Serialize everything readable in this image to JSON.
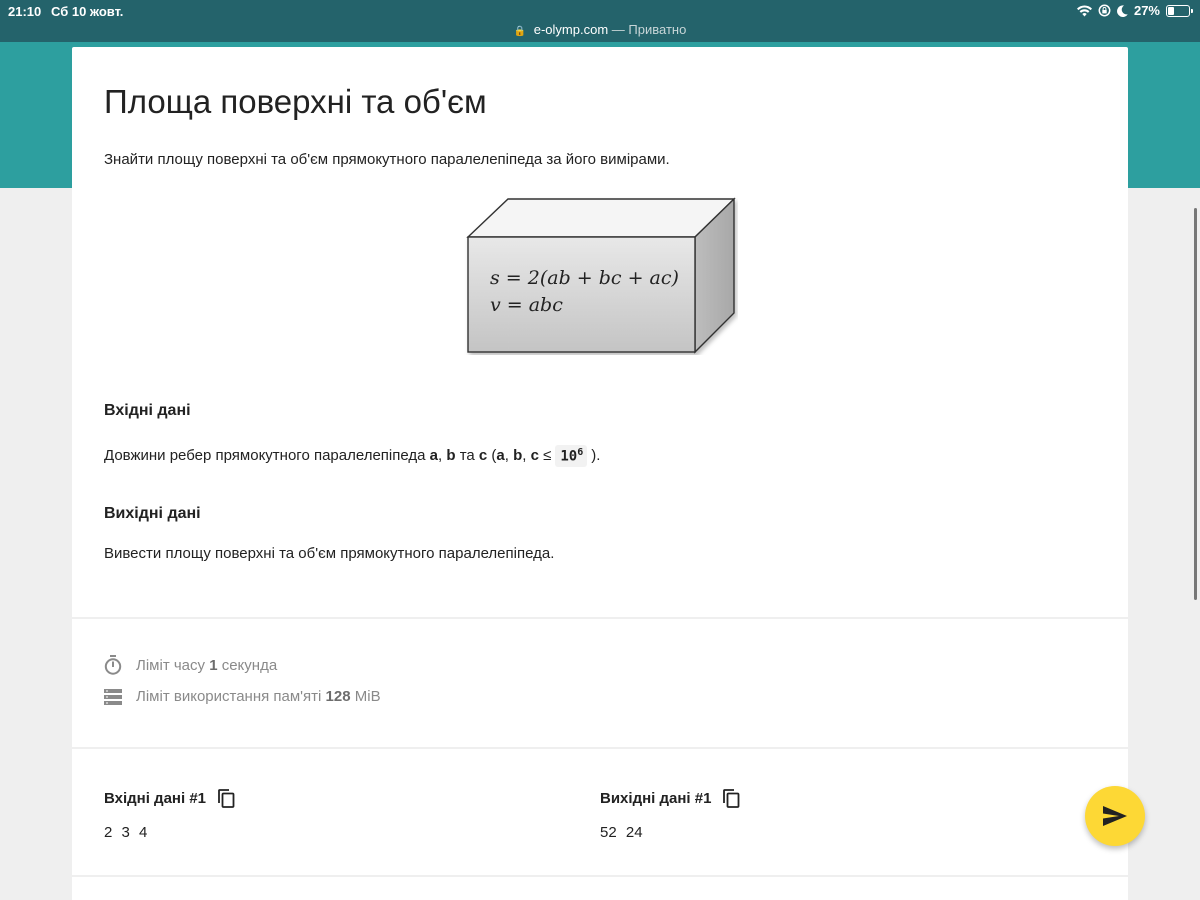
{
  "status": {
    "time": "21:10",
    "date": "Сб 10 жовт.",
    "battery": "27%"
  },
  "browser": {
    "domain": "e-olymp.com",
    "separator": "—",
    "mode": "Приватно"
  },
  "problem": {
    "title": "Площа поверхні та об'єм",
    "intro": "Знайти площу поверхні та об'єм прямокутного паралелепіпеда за його вимірами.",
    "figure": {
      "formula_s": "s = 2(ab + bc + ac)",
      "formula_v": "v = abc"
    },
    "input": {
      "heading": "Вхідні дані",
      "text_prefix": "Довжини ребер прямокутного паралелепіпеда",
      "var_a": "a",
      "var_b": "b",
      "word_and": "та",
      "var_c": "c",
      "constraint_open": "(",
      "constraint_sep": ",",
      "constraint_rel": "≤",
      "limit_base": "10",
      "limit_exp": "6",
      "constraint_close": ")."
    },
    "output": {
      "heading": "Вихідні дані",
      "text": "Вивести площу поверхні та об'єм прямокутного паралелепіпеда."
    }
  },
  "limits": {
    "time_label": "Ліміт часу",
    "time_value": "1",
    "time_unit": "секунда",
    "memory_label": "Ліміт використання пам'яті",
    "memory_value": "128",
    "memory_unit": "MiB"
  },
  "samples": {
    "input_heading": "Вхідні дані #1",
    "input_value": "2 3 4",
    "output_heading": "Вихідні дані #1",
    "output_value": "52 24"
  },
  "icons": [
    "wifi-icon",
    "lock-rotation-icon",
    "moon-icon",
    "battery-icon",
    "lock-icon",
    "timer-icon",
    "memory-icon",
    "copy-icon",
    "send-icon"
  ],
  "colors": {
    "status_bar": "#24636b",
    "header_band": "#2d9f9f",
    "fab": "#fdd835"
  }
}
